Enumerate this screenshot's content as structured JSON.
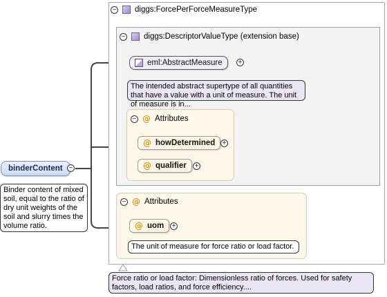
{
  "root": {
    "label": "binderContent",
    "doc": "Binder content of mixed soil, equal to the ratio of dry unit weights of the soil and slurry times the volume ratio."
  },
  "outer_type": {
    "title": "diggs:ForcePerForceMeasureType",
    "doc": "Force ratio or load factor: Dimensionless ratio of forces. Used for safety factors, load ratios, and force efficiency...."
  },
  "inner_type": {
    "title": "diggs:DescriptorValueType (extension base)"
  },
  "abstract_measure": {
    "label": "eml:AbstractMeasure",
    "doc": "The intended abstract supertype of all quantities that have a value with a unit of measure. The unit of measure is in..."
  },
  "inner_attributes": {
    "title": "Attributes",
    "items": [
      {
        "label": "howDetermined"
      },
      {
        "label": "qualifier"
      }
    ]
  },
  "outer_attributes": {
    "title": "Attributes",
    "uom": {
      "label": "uom",
      "doc": "The unit of measure for force ratio or load factor."
    }
  },
  "glyphs": {
    "minus": "−",
    "plus": "+",
    "at": "@"
  },
  "colors": {
    "type_icon": "#9f8fc7",
    "attr_bg": "#fdf7ea",
    "attr_at": "#d49a1a",
    "root_bg": "#cbdaf0",
    "doc_purple": "#ebe6f6"
  }
}
